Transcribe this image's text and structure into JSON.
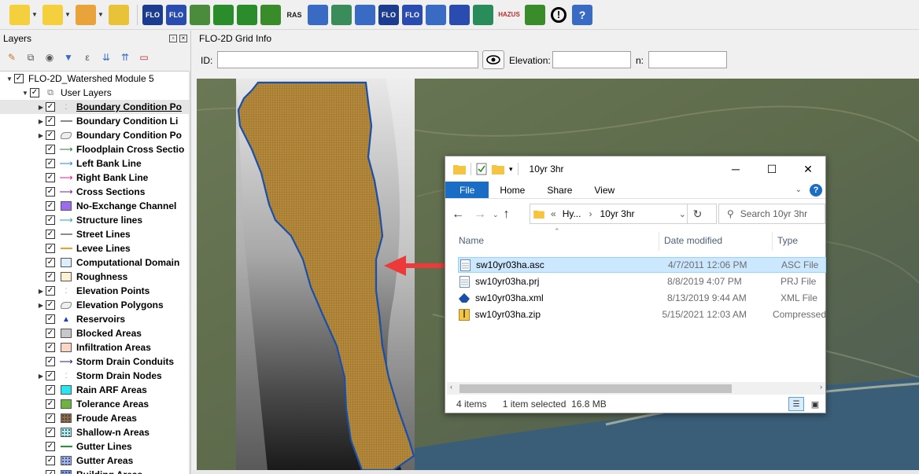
{
  "toolbar": {
    "buttons": [
      {
        "icon": "select-features-icon",
        "color": "#f4d03f",
        "dropdown": true
      },
      {
        "icon": "select-by-area-icon",
        "color": "#f4d03f",
        "dropdown": true
      },
      {
        "icon": "deselect-icon",
        "color": "#e8a33a",
        "dropdown": true
      },
      {
        "icon": "identify-feature-icon",
        "color": "#e8c33a",
        "dropdown": false
      },
      {
        "icon": "flo-2d-logo-icon",
        "color": "#1c3c8f",
        "dropdown": false
      },
      {
        "icon": "flo-2d-model-icon",
        "color": "#2a4bb0",
        "dropdown": false
      },
      {
        "icon": "import-gds-icon",
        "color": "#4a8c3c",
        "dropdown": false
      },
      {
        "icon": "grid-tool-icon",
        "color": "#2a8c2a",
        "dropdown": false
      },
      {
        "icon": "grid-tool-2-icon",
        "color": "#2a8c2a",
        "dropdown": false
      },
      {
        "icon": "elevation-tool-icon",
        "color": "#3a8c2a",
        "dropdown": false
      },
      {
        "icon": "ras-import-icon",
        "color": "#1a1a1a",
        "dropdown": false
      },
      {
        "icon": "table-editor-icon",
        "color": "#3a6bc4",
        "dropdown": false
      },
      {
        "icon": "profile-icon",
        "color": "#3a8c5a",
        "dropdown": false
      },
      {
        "icon": "profile-2-icon",
        "color": "#3a6bc4",
        "dropdown": false
      },
      {
        "icon": "flo-2d-run-icon",
        "color": "#1c3c8f",
        "dropdown": false
      },
      {
        "icon": "flo-2d-info-icon",
        "color": "#2a4bb0",
        "dropdown": false
      },
      {
        "icon": "help-person-icon",
        "color": "#3a6bc4",
        "dropdown": false
      },
      {
        "icon": "data-chart-icon",
        "color": "#2a4bb0",
        "dropdown": false
      },
      {
        "icon": "hills-icon",
        "color": "#2a8c5a",
        "dropdown": false
      },
      {
        "icon": "hazus-icon",
        "color": "#c22a2a",
        "dropdown": false
      },
      {
        "icon": "bar-graph-icon",
        "color": "#3a8c2a",
        "dropdown": false
      },
      {
        "icon": "warning-icon",
        "color": "#000000",
        "dropdown": false
      },
      {
        "icon": "help-question-icon",
        "color": "#3a6bc4",
        "dropdown": false
      }
    ],
    "hazus_label": "HAZUS",
    "ras_label": "RAS",
    "flo_label": "FLO"
  },
  "layers": {
    "title": "Layers",
    "groups": [
      {
        "label": "FLO-2D_Watershed Module 5",
        "level": 0,
        "expanded": true,
        "checked": true
      },
      {
        "label": "User Layers",
        "level": 1,
        "expanded": true,
        "checked": true
      }
    ],
    "items": [
      {
        "label": "Boundary Condition Po",
        "sym": "points-icon",
        "color": "#888888",
        "expander": true,
        "selected": true,
        "underline": true
      },
      {
        "label": "Boundary Condition Li",
        "sym": "line-icon",
        "color": "#888888",
        "expander": true
      },
      {
        "label": "Boundary Condition Po",
        "sym": "polygon-icon",
        "color": "#888888",
        "expander": true
      },
      {
        "label": "Floodplain Cross Sectio",
        "sym": "arrow-line-icon",
        "color": "#2e7d32",
        "expander": false
      },
      {
        "label": "Left Bank Line",
        "sym": "arrow-line-icon",
        "color": "#1e88e5",
        "expander": false
      },
      {
        "label": "Right Bank Line",
        "sym": "arrow-line-icon",
        "color": "#e91e96",
        "expander": false
      },
      {
        "label": "Cross Sections",
        "sym": "arrow-line-icon",
        "color": "#7b1fa2",
        "expander": false
      },
      {
        "label": "No-Exchange Channel",
        "sym": "fill-icon",
        "color": "#9c6cf0",
        "expander": false
      },
      {
        "label": "Structure lines",
        "sym": "arrow-line-icon",
        "color": "#26a69a",
        "expander": false
      },
      {
        "label": "Street Lines",
        "sym": "line-icon",
        "color": "#8c8c8c",
        "expander": false
      },
      {
        "label": "Levee Lines",
        "sym": "line-icon",
        "color": "#f59b2a",
        "expander": false
      },
      {
        "label": "Computational Domain",
        "sym": "fill-icon",
        "color": "#dceefc",
        "expander": false
      },
      {
        "label": "Roughness",
        "sym": "fill-icon",
        "color": "#fdf1d4",
        "expander": false
      },
      {
        "label": "Elevation Points",
        "sym": "points-icon",
        "color": "#888888",
        "expander": true
      },
      {
        "label": "Elevation Polygons",
        "sym": "polygon-icon",
        "color": "#888888",
        "expander": true
      },
      {
        "label": "Reservoirs",
        "sym": "triangle-icon",
        "color": "#1e3cc8",
        "expander": false
      },
      {
        "label": "Blocked Areas",
        "sym": "fill-icon",
        "color": "#c8c8c8",
        "expander": false
      },
      {
        "label": "Infiltration Areas",
        "sym": "fill-icon",
        "color": "#fcd6c4",
        "expander": false
      },
      {
        "label": "Storm Drain Conduits",
        "sym": "arrow-line-icon",
        "color": "#1a237e",
        "expander": false
      },
      {
        "label": "Storm Drain Nodes",
        "sym": "points-icon",
        "color": "#888888",
        "expander": true
      },
      {
        "label": "Rain ARF Areas",
        "sym": "fill-icon",
        "color": "#26e6f4",
        "expander": false
      },
      {
        "label": "Tolerance Areas",
        "sym": "fill-icon",
        "color": "#6db33f",
        "expander": false
      },
      {
        "label": "Froude Areas",
        "sym": "dotted-fill-icon",
        "color": "#8c6a4a",
        "expander": false
      },
      {
        "label": "Shallow-n Areas",
        "sym": "dotted-fill-icon",
        "color": "#a6ecf4",
        "expander": false
      },
      {
        "label": "Gutter Lines",
        "sym": "line-icon",
        "color": "#1a9c2a",
        "expander": false
      },
      {
        "label": "Gutter Areas",
        "sym": "dotted-fill-icon",
        "color": "#9cb4f0",
        "expander": false
      },
      {
        "label": "Building Areas",
        "sym": "dotted-fill-icon",
        "color": "#7c9cf0",
        "expander": false
      }
    ]
  },
  "grid_info": {
    "title": "FLO-2D Grid Info",
    "id_label": "ID:",
    "id_value": "",
    "elevation_label": "Elevation:",
    "elevation_value": "",
    "n_label": "n:",
    "n_value": ""
  },
  "explorer": {
    "title": "10yr 3hr",
    "ribbon": {
      "file": "File",
      "home": "Home",
      "share": "Share",
      "view": "View"
    },
    "address": {
      "ellipsis": "«",
      "parent": "Hy...",
      "sep": "›",
      "current": "10yr 3hr"
    },
    "search_placeholder": "Search 10yr 3hr",
    "columns": {
      "name": "Name",
      "date": "Date modified",
      "type": "Type"
    },
    "files": [
      {
        "name": "sw10yr03ha.asc",
        "date": "4/7/2011 12:06 PM",
        "type": "ASC File",
        "icon": "text-file-icon",
        "selected": true
      },
      {
        "name": "sw10yr03ha.prj",
        "date": "8/8/2019 4:07 PM",
        "type": "PRJ File",
        "icon": "text-file-icon",
        "selected": false
      },
      {
        "name": "sw10yr03ha.xml",
        "date": "8/13/2019 9:44 AM",
        "type": "XML File",
        "icon": "xml-file-icon",
        "selected": false
      },
      {
        "name": "sw10yr03ha.zip",
        "date": "5/15/2021 12:03 AM",
        "type": "Compressed",
        "icon": "zip-file-icon",
        "selected": false
      }
    ],
    "status": {
      "count": "4 items",
      "selection": "1 item selected  16.8 MB"
    }
  }
}
